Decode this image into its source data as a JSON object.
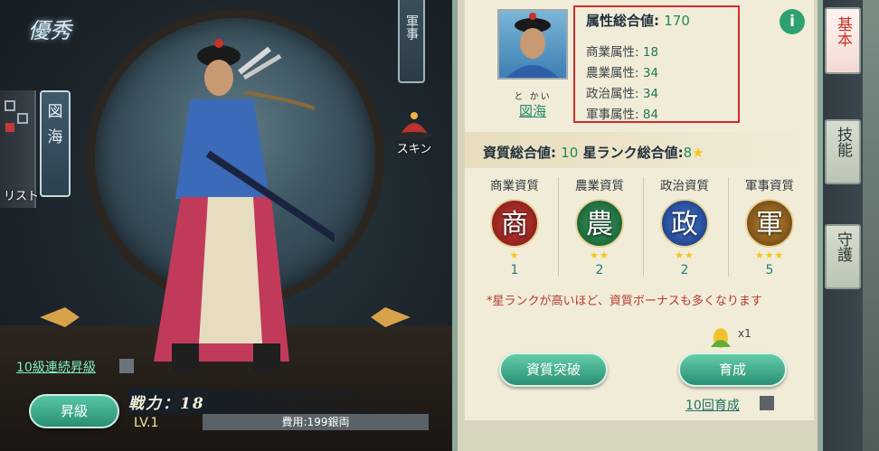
{
  "left": {
    "calligraphy": "優秀",
    "banner_name": "図海",
    "list_label": "リスト",
    "military_tab": "軍事",
    "skin_label": "スキン",
    "ten_level_up": "10級連続昇級",
    "upgrade_button": "昇級",
    "power_label": "戦力：",
    "power_value": "18",
    "level": "LV.1",
    "cost_text": "費用:199銀両"
  },
  "panel": {
    "furigana": "と かい",
    "name": "図海",
    "attr_total_label": "属性総合値:",
    "attr_total_value": "170",
    "attributes": [
      {
        "label": "商業属性:",
        "value": "18"
      },
      {
        "label": "農業属性:",
        "value": "34"
      },
      {
        "label": "政治属性:",
        "value": "34"
      },
      {
        "label": "軍事属性:",
        "value": "84"
      }
    ],
    "info_icon": "i",
    "quality_total_label": "資質総合値:",
    "quality_total_value": "10",
    "star_total_label": "星ランク総合値:",
    "star_total_value": "8",
    "qualities": [
      {
        "title": "商業資質",
        "glyph": "商",
        "stars": "★",
        "value": "1",
        "color": "#9b1f1c"
      },
      {
        "title": "農業資質",
        "glyph": "農",
        "stars": "★★",
        "value": "2",
        "color": "#1f6f3a"
      },
      {
        "title": "政治資質",
        "glyph": "政",
        "stars": "★★",
        "value": "2",
        "color": "#1f4c9b"
      },
      {
        "title": "軍事資質",
        "glyph": "軍",
        "stars": "★★★",
        "value": "5",
        "color": "#7a4a12"
      }
    ],
    "note": "*星ランクが高いほど、資質ボーナスも多くなります",
    "cost_count": "x1",
    "breakthrough_button": "資質突破",
    "train_button": "育成",
    "ten_train": "10回育成"
  },
  "tabs": [
    {
      "label": "基本",
      "active": true
    },
    {
      "label": "技能",
      "active": false
    },
    {
      "label": "守護",
      "active": false
    }
  ]
}
